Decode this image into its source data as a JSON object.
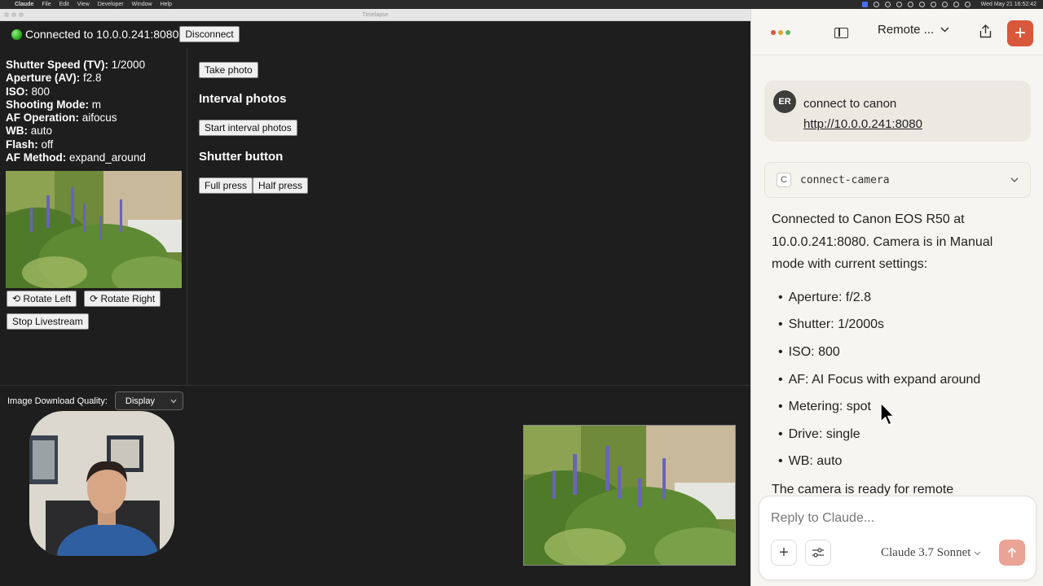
{
  "menubar": {
    "app_name": "Claude",
    "items": [
      "File",
      "Edit",
      "View",
      "Developer",
      "Window",
      "Help"
    ],
    "clock": "Wed May 21  16:52:42"
  },
  "window": {
    "title": "Timelapse"
  },
  "connection": {
    "status_text": "Connected to 10.0.0.241:8080",
    "disconnect_label": "Disconnect",
    "status_color": "#1fa319"
  },
  "settings": [
    {
      "label": "Shutter Speed (TV):",
      "value": "1/2000"
    },
    {
      "label": "Aperture (AV):",
      "value": "f2.8"
    },
    {
      "label": "ISO:",
      "value": "800"
    },
    {
      "label": "Shooting Mode:",
      "value": "m"
    },
    {
      "label": "AF Operation:",
      "value": "aifocus"
    },
    {
      "label": "WB:",
      "value": "auto"
    },
    {
      "label": "Flash:",
      "value": "off"
    },
    {
      "label": "AF Method:",
      "value": "expand_around"
    }
  ],
  "preview_controls": {
    "rotate_left": "⟲ Rotate Left",
    "rotate_right": "⟳ Rotate Right",
    "stop_livestream": "Stop Livestream"
  },
  "controls": {
    "take_photo": "Take photo",
    "interval_title": "Interval photos",
    "start_interval": "Start interval photos",
    "shutter_title": "Shutter button",
    "full_press": "Full press",
    "half_press": "Half press"
  },
  "download": {
    "label": "Image Download Quality:",
    "selected": "Display"
  },
  "chat": {
    "conversation_title": "Remote ...",
    "accent": "#d9573b",
    "user": {
      "initials": "ER",
      "line1": "connect to canon",
      "link": "http://10.0.0.241:8080"
    },
    "tool": {
      "badge": "C",
      "name": "connect-camera"
    },
    "reply": {
      "intro": "Connected to Canon EOS R50 at 10.0.0.241:8080. Camera is in Manual mode with current settings:",
      "bullets": [
        "Aperture: f/2.8",
        "Shutter: 1/2000s",
        "ISO: 800",
        "AF: AI Focus with expand around",
        "Metering: spot",
        "Drive: single",
        "WB: auto"
      ],
      "tail": "The camera is ready for remote"
    },
    "composer": {
      "placeholder": "Reply to Claude...",
      "model": "Claude 3.7 Sonnet"
    }
  }
}
